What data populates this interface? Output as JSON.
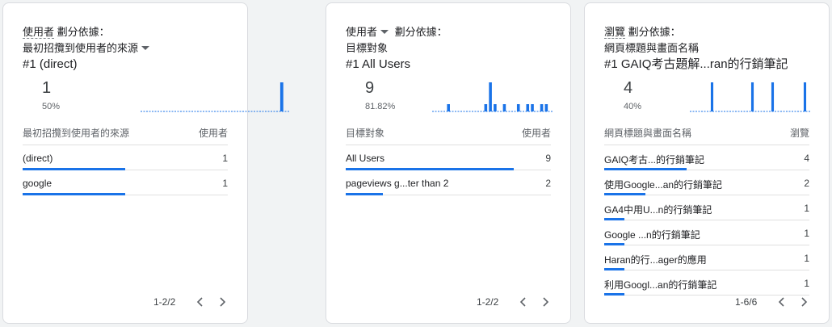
{
  "cards": [
    {
      "metric_label": "使用者",
      "metric_has_dropdown": false,
      "breakdown_label": "劃分依據：",
      "dimension_label": "最初招攬到使用者的來源",
      "dimension_has_dropdown": true,
      "top_item": "#1  (direct)",
      "top_value": "1",
      "top_percent": "50%",
      "table_dim_header": "最初招攬到使用者的來源",
      "table_metric_header": "使用者",
      "rows": [
        {
          "label": "(direct)",
          "value": "1",
          "bar_fraction": 0.5
        },
        {
          "label": "google",
          "value": "1",
          "bar_fraction": 0.5
        }
      ],
      "sparkline": [
        0,
        0,
        0,
        0,
        0,
        0,
        0,
        0,
        0,
        0,
        0,
        0,
        0,
        0,
        0,
        0,
        0,
        0,
        0,
        0,
        0,
        0,
        0,
        0,
        0,
        0,
        0,
        0,
        1,
        0
      ],
      "pagination": "1-2/2"
    },
    {
      "metric_label": "使用者",
      "metric_has_dropdown": true,
      "breakdown_label": "劃分依據：",
      "dimension_label": "目標對象",
      "dimension_has_dropdown": false,
      "top_item": "#1  All Users",
      "top_value": "9",
      "top_percent": "81.82%",
      "table_dim_header": "目標對象",
      "table_metric_header": "使用者",
      "rows": [
        {
          "label": "All Users",
          "value": "9",
          "bar_fraction": 0.818
        },
        {
          "label": "pageviews g...ter than 2",
          "value": "2",
          "bar_fraction": 0.182
        }
      ],
      "sparkline": [
        0,
        0,
        0,
        1,
        0,
        0,
        0,
        0,
        0,
        0,
        0,
        1,
        4,
        1,
        0,
        1,
        0,
        0,
        1,
        0,
        1,
        1,
        0,
        1,
        1,
        0
      ],
      "pagination": "1-2/2"
    },
    {
      "metric_label": "瀏覽",
      "metric_has_dropdown": false,
      "breakdown_label": "劃分依據：",
      "dimension_label": "網頁標題與畫面名稱",
      "dimension_has_dropdown": false,
      "top_item": "#1  GAIQ考古題解...ran的行銷筆記",
      "top_value": "4",
      "top_percent": "40%",
      "table_dim_header": "網頁標題與畫面名稱",
      "table_metric_header": "瀏覽",
      "rows": [
        {
          "label": "GAIQ考古...的行銷筆記",
          "value": "4",
          "bar_fraction": 0.4
        },
        {
          "label": "使用Google...an的行銷筆記",
          "value": "2",
          "bar_fraction": 0.2
        },
        {
          "label": "GA4中用U...n的行銷筆記",
          "value": "1",
          "bar_fraction": 0.1
        },
        {
          "label": "Google ...n的行銷筆記",
          "value": "1",
          "bar_fraction": 0.1
        },
        {
          "label": "Haran的行...ager的應用",
          "value": "1",
          "bar_fraction": 0.1
        },
        {
          "label": "利用Googl...an的行銷筆記",
          "value": "1",
          "bar_fraction": 0.1
        }
      ],
      "sparkline": [
        0,
        0,
        0,
        0,
        0,
        1,
        0,
        0,
        0,
        0,
        0,
        0,
        0,
        0,
        0,
        1,
        0,
        0,
        0,
        0,
        1,
        0,
        0,
        0,
        0,
        0,
        0,
        0,
        1,
        0
      ],
      "pagination": "1-6/6"
    }
  ],
  "colors": {
    "accent": "#1a73e8",
    "baseline": "#1a73e8"
  },
  "icons": {
    "prev": "chevron-left-icon",
    "next": "chevron-right-icon",
    "dropdown": "caret-down-icon"
  }
}
